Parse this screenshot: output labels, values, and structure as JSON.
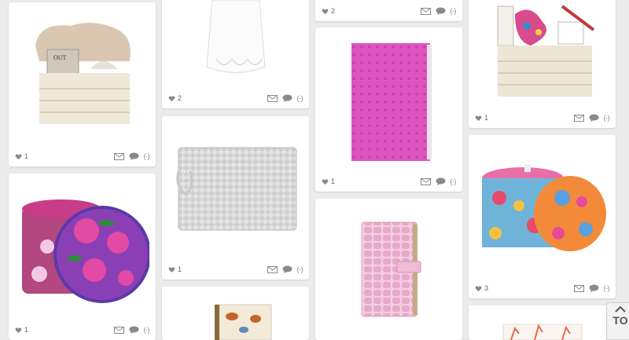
{
  "pins": [
    {
      "id": "basket-towels",
      "likes": "1",
      "icon": "basket-with-towels"
    },
    {
      "id": "flower-box",
      "likes": "1",
      "icon": "floral-hatbox"
    },
    {
      "id": "white-dress",
      "likes": "2",
      "icon": "white-lace-dress"
    },
    {
      "id": "silver-clutch",
      "likes": "1",
      "icon": "silver-clutch"
    },
    {
      "id": "butterfly-book",
      "likes": "",
      "icon": "butterfly-box"
    },
    {
      "id": "top-partial",
      "likes": "2",
      "icon": "blank"
    },
    {
      "id": "pink-notebook",
      "likes": "1",
      "icon": "pink-ostrich-notebook"
    },
    {
      "id": "croc-diary",
      "likes": "",
      "icon": "pink-croc-diary"
    },
    {
      "id": "gift-basket",
      "likes": "1",
      "icon": "gift-basket"
    },
    {
      "id": "paisley-boxes",
      "likes": "3",
      "icon": "paisley-boxes"
    },
    {
      "id": "coral-box",
      "likes": "",
      "icon": "coral-print-box"
    }
  ],
  "actions": {
    "more_label": "(-)"
  },
  "top_button": {
    "label": "TO"
  },
  "colors": {
    "background": "#ebebeb",
    "card": "#ffffff",
    "pink": "#d64fb4"
  }
}
